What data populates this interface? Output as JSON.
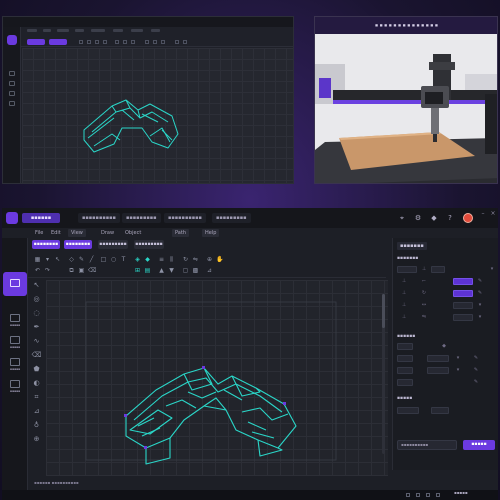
{
  "panel_small": {
    "menu_count": 8
  },
  "panel_photo": {
    "title": "▪▪▪▪▪▪▪▪▪▪▪▪▪▪"
  },
  "app": {
    "name": "▪▪▪▪▪▪",
    "doc_tabs": [
      "▪▪▪▪▪▪▪▪▪▪",
      "▪▪▪▪▪▪▪▪▪",
      "▪▪▪▪▪▪▪▪▪▪",
      "▪▪▪▪▪▪▪▪▪"
    ],
    "menu": [
      "File",
      "Edit",
      "View",
      "Draw",
      "Object",
      "Path",
      "Help"
    ],
    "tabs": [
      {
        "label": "▪▪▪▪▪▪▪▪",
        "active": true
      },
      {
        "label": "▪▪▪▪▪▪▪▪",
        "active": true
      },
      {
        "label": "▪▪▪▪▪▪▪▪▪",
        "active": false
      },
      {
        "label": "▪▪▪▪▪▪▪▪▪",
        "active": false
      }
    ],
    "rail": [
      {
        "label": "▪▪▪▪▪",
        "icon": "file-icon"
      },
      {
        "label": "▪▪▪▪▪",
        "icon": "layers-icon"
      },
      {
        "label": "▪▪▪▪▪",
        "icon": "grid-icon"
      },
      {
        "label": "▪▪▪▪▪",
        "icon": "settings-icon"
      }
    ],
    "status": "▪▪▪▪▪▪  ▪▪▪▪▪▪▪▪▪▪",
    "clock": "▪▪▪▪▪"
  },
  "props": {
    "title": "▪▪▪▪▪▪▪",
    "section1": "▪▪▪▪▪▪▪",
    "section2": "▪▪▪▪▪▪",
    "section3": "▪▪▪▪▪",
    "preset": "▪▪▪▪▪▪▪▪▪▪",
    "apply_label": "▪▪▪▪▪"
  },
  "colors": {
    "accent": "#6b3ae0",
    "wireframe": "#2ad6c8"
  }
}
